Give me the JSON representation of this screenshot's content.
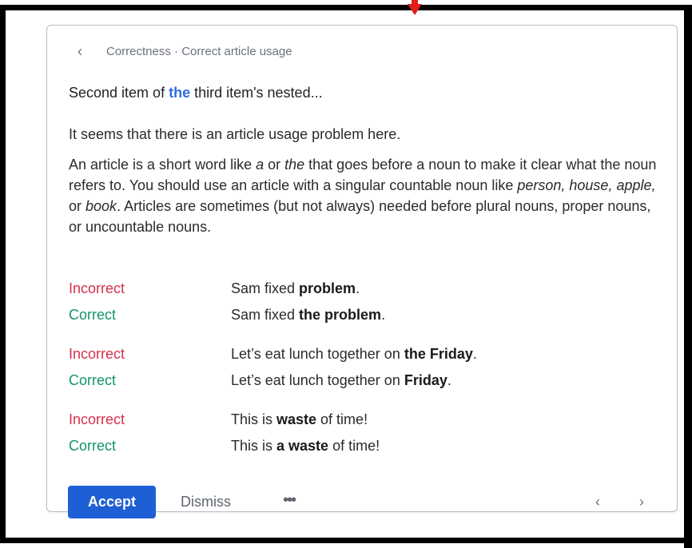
{
  "header": {
    "back_icon": "‹",
    "breadcrumb": "Correctness · Correct article usage"
  },
  "item": {
    "title_before": "Second item of ",
    "title_highlight": "the",
    "title_after": " third item's nested..."
  },
  "explanation": {
    "lead": "It seems that there is an article usage problem here.",
    "p1": "An article is a short word like ",
    "p1_a": "a",
    "p1_mid": " or ",
    "p1_the": "the",
    "p1_rest": " that goes before a noun to make it clear what the noun refers to. You should use an article with a singular countable noun like ",
    "p1_examples": "person, house, apple,",
    "p1_or": " or ",
    "p1_book": "book",
    "p1_end": ". Articles are sometimes (but not always) needed before plural nouns, proper nouns, or uncountable nouns."
  },
  "examples": [
    {
      "label": "Incorrect",
      "pre": "Sam fixed ",
      "bold": "problem",
      "post": "."
    },
    {
      "label": "Correct",
      "pre": "Sam fixed ",
      "bold": "the problem",
      "post": "."
    },
    {
      "label": "Incorrect",
      "pre": "Let’s eat lunch together on ",
      "bold": "the Friday",
      "post": "."
    },
    {
      "label": "Correct",
      "pre": "Let’s eat lunch together on ",
      "bold": "Friday",
      "post": "."
    },
    {
      "label": "Incorrect",
      "pre": "This is ",
      "bold": "waste",
      "post": " of time!"
    },
    {
      "label": "Correct",
      "pre": "This is ",
      "bold": "a waste",
      "post": " of time!"
    }
  ],
  "footer": {
    "accept_label": "Accept",
    "dismiss_label": "Dismiss",
    "more_label": "•••",
    "prev_icon": "‹",
    "next_icon": "›"
  },
  "colors": {
    "accent": "#1f5fd6",
    "highlight": "#2f6ee0",
    "incorrect": "#d62f4b",
    "correct": "#15946b",
    "marker": "#e11d1d"
  }
}
